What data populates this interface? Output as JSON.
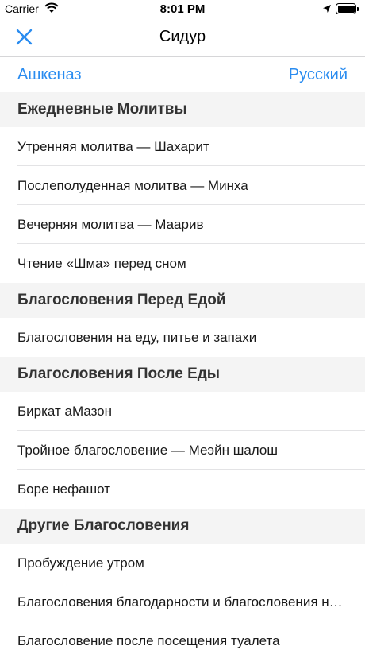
{
  "status": {
    "carrier": "Carrier",
    "time": "8:01 PM"
  },
  "nav": {
    "title": "Сидур",
    "close_icon": "close-icon"
  },
  "segment": {
    "left": "Ашкеназ",
    "right": "Русский"
  },
  "colors": {
    "accent": "#2a8cf0",
    "section_bg": "#f4f4f4"
  },
  "sections": [
    {
      "header": "Ежедневные Молитвы",
      "items": [
        "Утренняя молитва — Шахарит",
        "Послеполуденная молитва — Минха",
        "Вечерняя молитва — Маарив",
        "Чтение «Шма» перед сном"
      ]
    },
    {
      "header": "Благословения Перед Едой",
      "items": [
        "Благословения на еду, питье и запахи"
      ]
    },
    {
      "header": "Благословения После Еды",
      "items": [
        "Биркат аМазон",
        "Тройное благословение — Меэйн шалош",
        "Боре нефашот"
      ]
    },
    {
      "header": "Другие Благословения",
      "items": [
        "Пробуждение утром",
        "Благословения благодарности и благословения на заповеди",
        "Благословение после посещения туалета"
      ]
    }
  ]
}
